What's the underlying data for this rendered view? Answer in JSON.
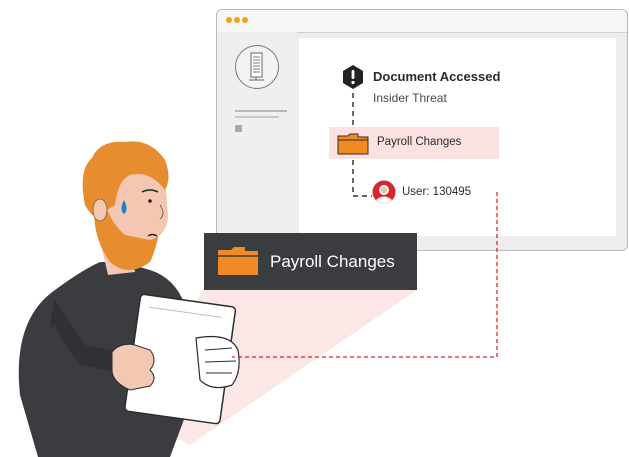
{
  "window": {
    "alert": {
      "title": "Document Accessed",
      "subtitle": "Insider Threat"
    },
    "folder": {
      "label": "Payroll Changes"
    },
    "user": {
      "label": "User: 130495"
    }
  },
  "callout": {
    "label": "Payroll Changes"
  },
  "colors": {
    "accent_orange": "#f08a24",
    "highlight_pink": "#fbe1e1",
    "alert_red": "#d9262e",
    "callout_dark": "#3a3c3f",
    "dashed_link": "#d9262e"
  },
  "icons": {
    "window_controls": "traffic-light-dots",
    "server": "server-tower-icon",
    "alert": "exclamation-shield-icon",
    "folder": "folder-icon",
    "user": "user-avatar-icon"
  }
}
